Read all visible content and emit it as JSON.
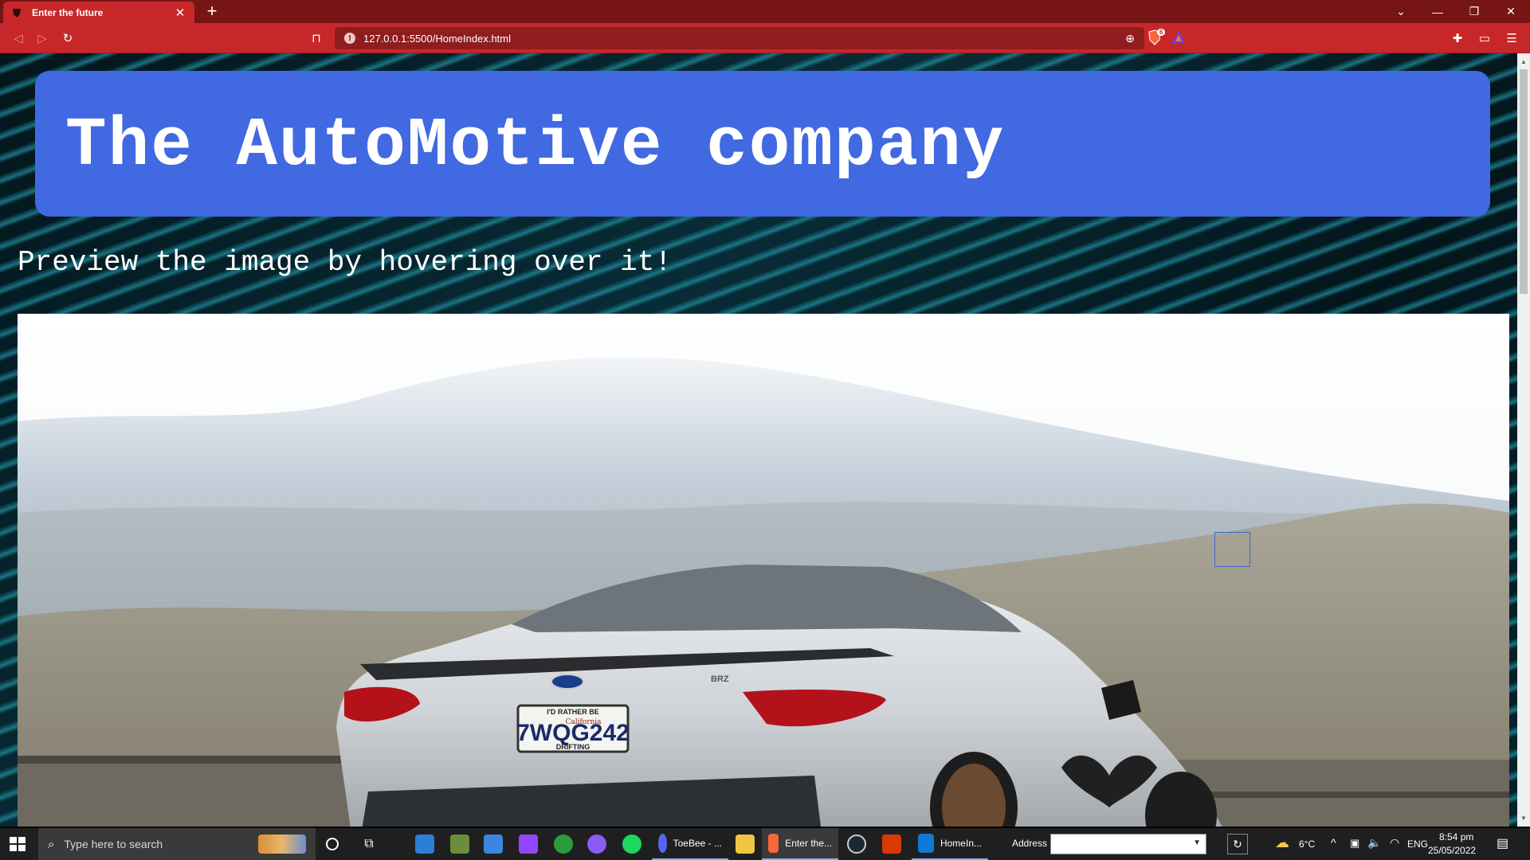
{
  "browser": {
    "tab_title": "Enter the future",
    "tab_close": "✕",
    "new_tab": "+",
    "url": "127.0.0.1:5500/HomeIndex.html",
    "shield_count": "6"
  },
  "page": {
    "title": "The AutoMotive company",
    "subtitle": "Preview the image by hovering over it!",
    "license_plate": "7WQG242",
    "plate_top": "I'D RATHER BE",
    "plate_bottom": "DRIFTING",
    "plate_state": "California",
    "car_model_badge": "BRZ"
  },
  "taskbar": {
    "search_placeholder": "Type here to search",
    "apps": [
      {
        "name": "discord",
        "label": "ToeBee - ..."
      },
      {
        "name": "brave",
        "label": "Enter the..."
      },
      {
        "name": "vscode",
        "label": "HomeIn..."
      }
    ],
    "address_label": "Address",
    "weather": "6°C",
    "language": "ENG",
    "time": "8:54 pm",
    "date": "25/05/2022"
  },
  "colors": {
    "accent_blue": "#4169e1",
    "browser_red": "#c8272a",
    "browser_dark_red": "#771515"
  }
}
